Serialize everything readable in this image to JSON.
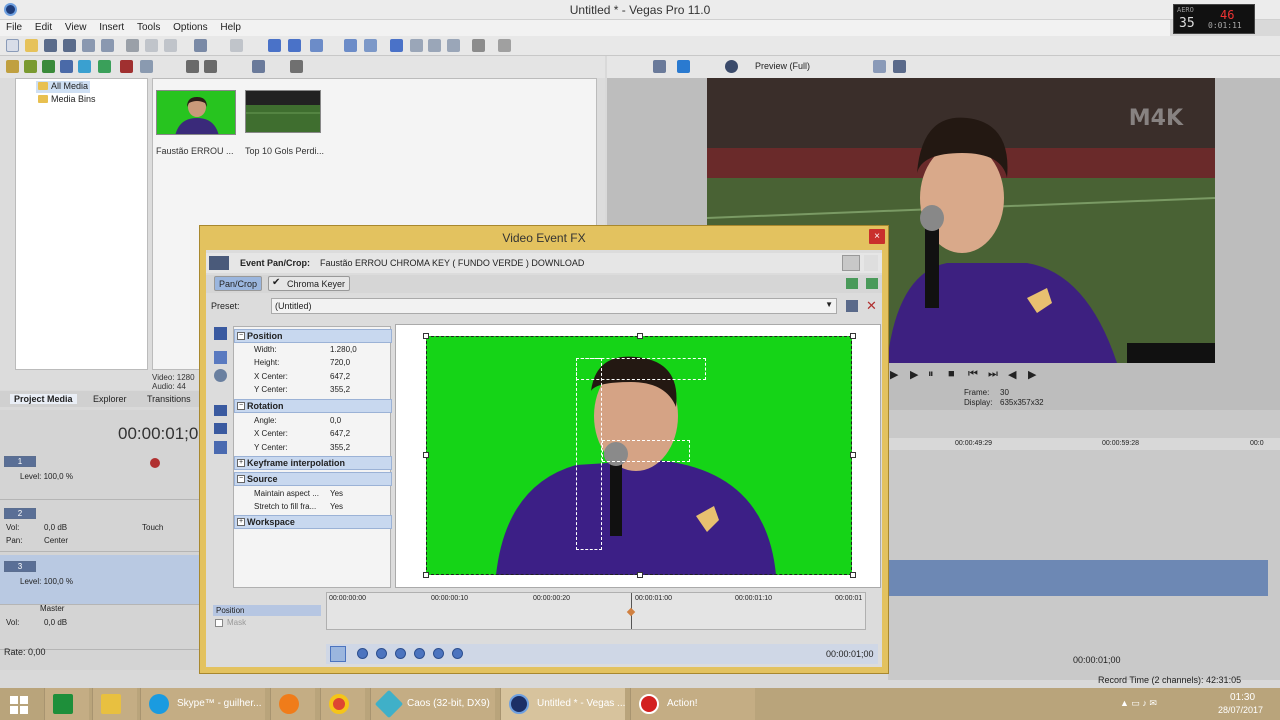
{
  "window": {
    "title": "Untitled * - Vegas Pro 11.0"
  },
  "menu": [
    "File",
    "Edit",
    "View",
    "Insert",
    "Tools",
    "Options",
    "Help"
  ],
  "recorder": {
    "label": "AERO",
    "fps": "35",
    "counter": "46",
    "time": "0:01:11"
  },
  "media_tree": {
    "items": [
      "All Media",
      "Media Bins"
    ]
  },
  "media_files": [
    {
      "name": "Faustão ERROU ..."
    },
    {
      "name": "Top 10 Gols Perdi..."
    }
  ],
  "media_info": {
    "video": "Video: 1280",
    "audio": "Audio: 44"
  },
  "left_tabs": [
    "Project Media",
    "Explorer",
    "Transitions"
  ],
  "timecode": "00:00:01;0",
  "tracks": [
    {
      "num": "1",
      "level": "Level: 100,0 %"
    },
    {
      "num": "2",
      "vol_label": "Vol:",
      "vol_value": "0,0 dB",
      "pan_label": "Pan:",
      "pan_value": "Center",
      "mode": "Touch"
    },
    {
      "num": "3",
      "level": "Level: 100,0 %"
    },
    {
      "name": "Master",
      "vol_label": "Vol:",
      "vol_value": "0,0 dB"
    }
  ],
  "rate": "Rate: 0,00",
  "preview": {
    "mode": "Preview (Full)",
    "frame_label": "Frame:",
    "frame_value": "30",
    "display_label": "Display:",
    "display_value": "635x357x32",
    "watermark": "M4K"
  },
  "ruler": [
    "00:00:49:29",
    "00:00:59:28",
    "00:0"
  ],
  "bottom_status": {
    "timecode": "00:00:01;00",
    "record_time": "Record Time (2 channels): 42:31:05"
  },
  "dialog": {
    "title": "Video Event FX",
    "close": "×",
    "event_label": "Event Pan/Crop:",
    "event_value": "Faustão ERROU   CHROMA KEY ( FUNDO VERDE ) DOWNLOAD",
    "tabs": [
      "Pan/Crop",
      "Chroma Keyer"
    ],
    "preset_label": "Preset:",
    "preset_value": "(Untitled)",
    "sections": {
      "position": {
        "title": "Position",
        "rows": [
          [
            "Width:",
            "1.280,0"
          ],
          [
            "Height:",
            "720,0"
          ],
          [
            "X Center:",
            "647,2"
          ],
          [
            "Y Center:",
            "355,2"
          ]
        ]
      },
      "rotation": {
        "title": "Rotation",
        "rows": [
          [
            "Angle:",
            "0,0"
          ],
          [
            "X Center:",
            "647,2"
          ],
          [
            "Y Center:",
            "355,2"
          ]
        ]
      },
      "keyframe": {
        "title": "Keyframe interpolation"
      },
      "source": {
        "title": "Source",
        "rows": [
          [
            "Maintain aspect ...",
            "Yes"
          ],
          [
            "Stretch to fill fra...",
            "Yes"
          ]
        ]
      },
      "workspace": {
        "title": "Workspace"
      }
    },
    "keyframe_tracks": [
      "Position",
      "Mask"
    ],
    "keyframe_ruler": [
      "00:00:00:00",
      "00:00:00:10",
      "00:00:00:20",
      "00:00:01:00",
      "00:00:01:10",
      "00:00:01"
    ],
    "cursor_time": "00:00:01;00"
  },
  "taskbar": {
    "items": [
      {
        "label": "",
        "color": "#1e8f3a"
      },
      {
        "label": "",
        "color": "#e8c040"
      },
      {
        "label": "Skype™ - guilher...",
        "color": "#1a9be0"
      },
      {
        "label": "",
        "color": "#f07c1a"
      },
      {
        "label": "",
        "color": "#de4632"
      },
      {
        "label": "Caos (32-bit, DX9)",
        "color": "#3fb0c8"
      },
      {
        "label": "Untitled * - Vegas ...",
        "color": "#1c2f66"
      },
      {
        "label": "Action!",
        "color": "#d32020"
      }
    ],
    "clock_time": "01:30",
    "clock_date": "28/07/2017"
  },
  "colors": {
    "dialog_frame": "#e3c25f",
    "chroma_green": "#15d417",
    "selection": "#6d88b4"
  }
}
